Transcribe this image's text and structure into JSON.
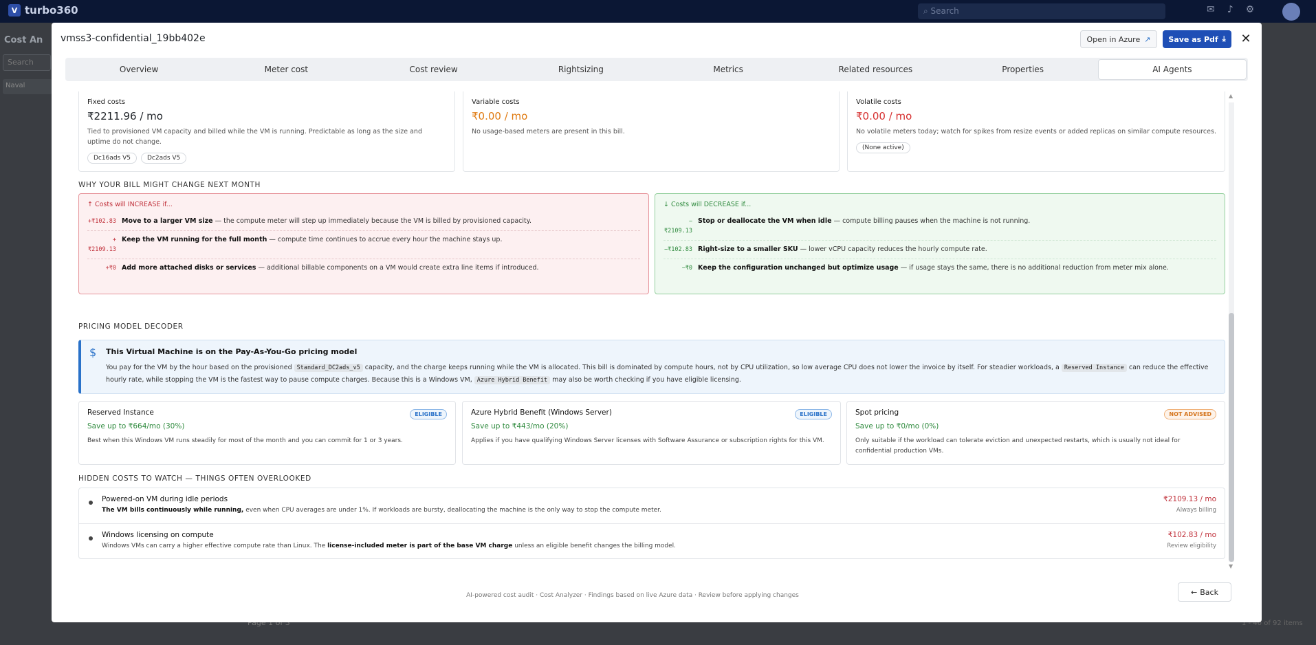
{
  "app": {
    "brand": "turbo360",
    "search_placeholder": "Search",
    "bg_title": "Cost An",
    "bg_search": "Search",
    "bg_tree": "Naval",
    "bg_pager": "Page 1 of 3",
    "bg_items": "1 - 40 of 92 items"
  },
  "modal": {
    "title": "vmss3-confidential_19bb402e",
    "open_azure": "Open in Azure",
    "save_pdf": "Save as Pdf",
    "close": "✕"
  },
  "tabs": [
    {
      "label": "Overview"
    },
    {
      "label": "Meter cost"
    },
    {
      "label": "Cost review"
    },
    {
      "label": "Rightsizing"
    },
    {
      "label": "Metrics"
    },
    {
      "label": "Related resources"
    },
    {
      "label": "Properties"
    },
    {
      "label": "AI Agents"
    }
  ],
  "cost_cards": {
    "fixed": {
      "label": "Fixed costs",
      "value": "₹2211.96 / mo",
      "desc": "Tied to provisioned VM capacity and billed while the VM is running. Predictable as long as the size and uptime do not change.",
      "chips": [
        "Dc16ads V5",
        "Dc2ads V5"
      ],
      "color": "#1f2328"
    },
    "variable": {
      "label": "Variable costs",
      "value": "₹0.00 / mo",
      "desc": "No usage-based meters are present in this bill.",
      "color": "#e07b12"
    },
    "volatile": {
      "label": "Volatile costs",
      "value": "₹0.00 / mo",
      "desc": "No volatile meters today; watch for spikes from resize events or added replicas on similar compute resources.",
      "chip": "(None active)",
      "color": "#d63030"
    }
  },
  "why_change": {
    "heading": "WHY YOUR BILL MIGHT CHANGE NEXT MONTH",
    "increase": {
      "title": "↑ Costs will INCREASE if...",
      "rows": [
        {
          "amount": "+₹102.83",
          "bold": "Move to a larger VM size",
          "text": " — the compute meter will step up immediately because the VM is billed by provisioned capacity."
        },
        {
          "amount": "+ ₹2109.13",
          "bold": "Keep the VM running for the full month",
          "text": " — compute time continues to accrue every hour the machine stays up."
        },
        {
          "amount": "+₹0",
          "bold": "Add more attached disks or services",
          "text": " — additional billable components on a VM would create extra line items if introduced."
        }
      ]
    },
    "decrease": {
      "title": "↓ Costs will DECREASE if...",
      "rows": [
        {
          "amount": "− ₹2109.13",
          "bold": "Stop or deallocate the VM when idle",
          "text": " — compute billing pauses when the machine is not running."
        },
        {
          "amount": "−₹102.83",
          "bold": "Right-size to a smaller SKU",
          "text": " — lower vCPU capacity reduces the hourly compute rate."
        },
        {
          "amount": "−₹0",
          "bold": "Keep the configuration unchanged but optimize usage",
          "text": " — if usage stays the same, there is no additional reduction from meter mix alone."
        }
      ]
    }
  },
  "decoder": {
    "heading": "PRICING MODEL DECODER",
    "icon": "$",
    "title": "This Virtual Machine is on the Pay-As-You-Go pricing model",
    "body_1": "You pay for the VM by the hour based on the provisioned ",
    "code_1": "Standard_DC2ads_v5",
    "body_2": " capacity, and the charge keeps running while the VM is allocated. This bill is dominated by compute hours, not by CPU utilization, so low average CPU does not lower the invoice by itself. For steadier workloads, a ",
    "code_2": "Reserved Instance",
    "body_3": " can reduce the effective hourly rate, while stopping the VM is the fastest way to pause compute charges. Because this is a Windows VM, ",
    "code_3": "Azure Hybrid Benefit",
    "body_4": " may also be worth checking if you have eligible licensing."
  },
  "plans": [
    {
      "title": "Reserved Instance",
      "badge": "ELIGIBLE",
      "save": "Save up to ₹664/mo (30%)",
      "desc": "Best when this Windows VM runs steadily for most of the month and you can commit for 1 or 3 years."
    },
    {
      "title": "Azure Hybrid Benefit (Windows Server)",
      "badge": "ELIGIBLE",
      "save": "Save up to ₹443/mo (20%)",
      "desc": "Applies if you have qualifying Windows Server licenses with Software Assurance or subscription rights for this VM."
    },
    {
      "title": "Spot pricing",
      "badge": "NOT ADVISED",
      "save": "Save up to ₹0/mo (0%)",
      "desc": "Only suitable if the workload can tolerate eviction and unexpected restarts, which is usually not ideal for confidential production VMs."
    }
  ],
  "hidden_costs": {
    "heading": "HIDDEN COSTS TO WATCH — THINGS OFTEN OVERLOOKED",
    "items": [
      {
        "title": "Powered-on VM during idle periods",
        "bold": "The VM bills continuously while running,",
        "text": " even when CPU averages are under 1%. If workloads are bursty, deallocating the machine is the only way to stop the compute meter.",
        "amount": "₹2109.13 / mo",
        "sub": "Always billing"
      },
      {
        "title": "Windows licensing on compute",
        "pre": "Windows VMs can carry a higher effective compute rate than Linux. The ",
        "bold": "license-included meter is part of the base VM charge",
        "text": " unless an eligible benefit changes the billing model.",
        "amount": "₹102.83 / mo",
        "sub": "Review eligibility"
      }
    ]
  },
  "footer": {
    "note": "AI-powered cost audit · Cost Analyzer · Findings based on live Azure data · Review before applying changes",
    "back": "Back"
  }
}
